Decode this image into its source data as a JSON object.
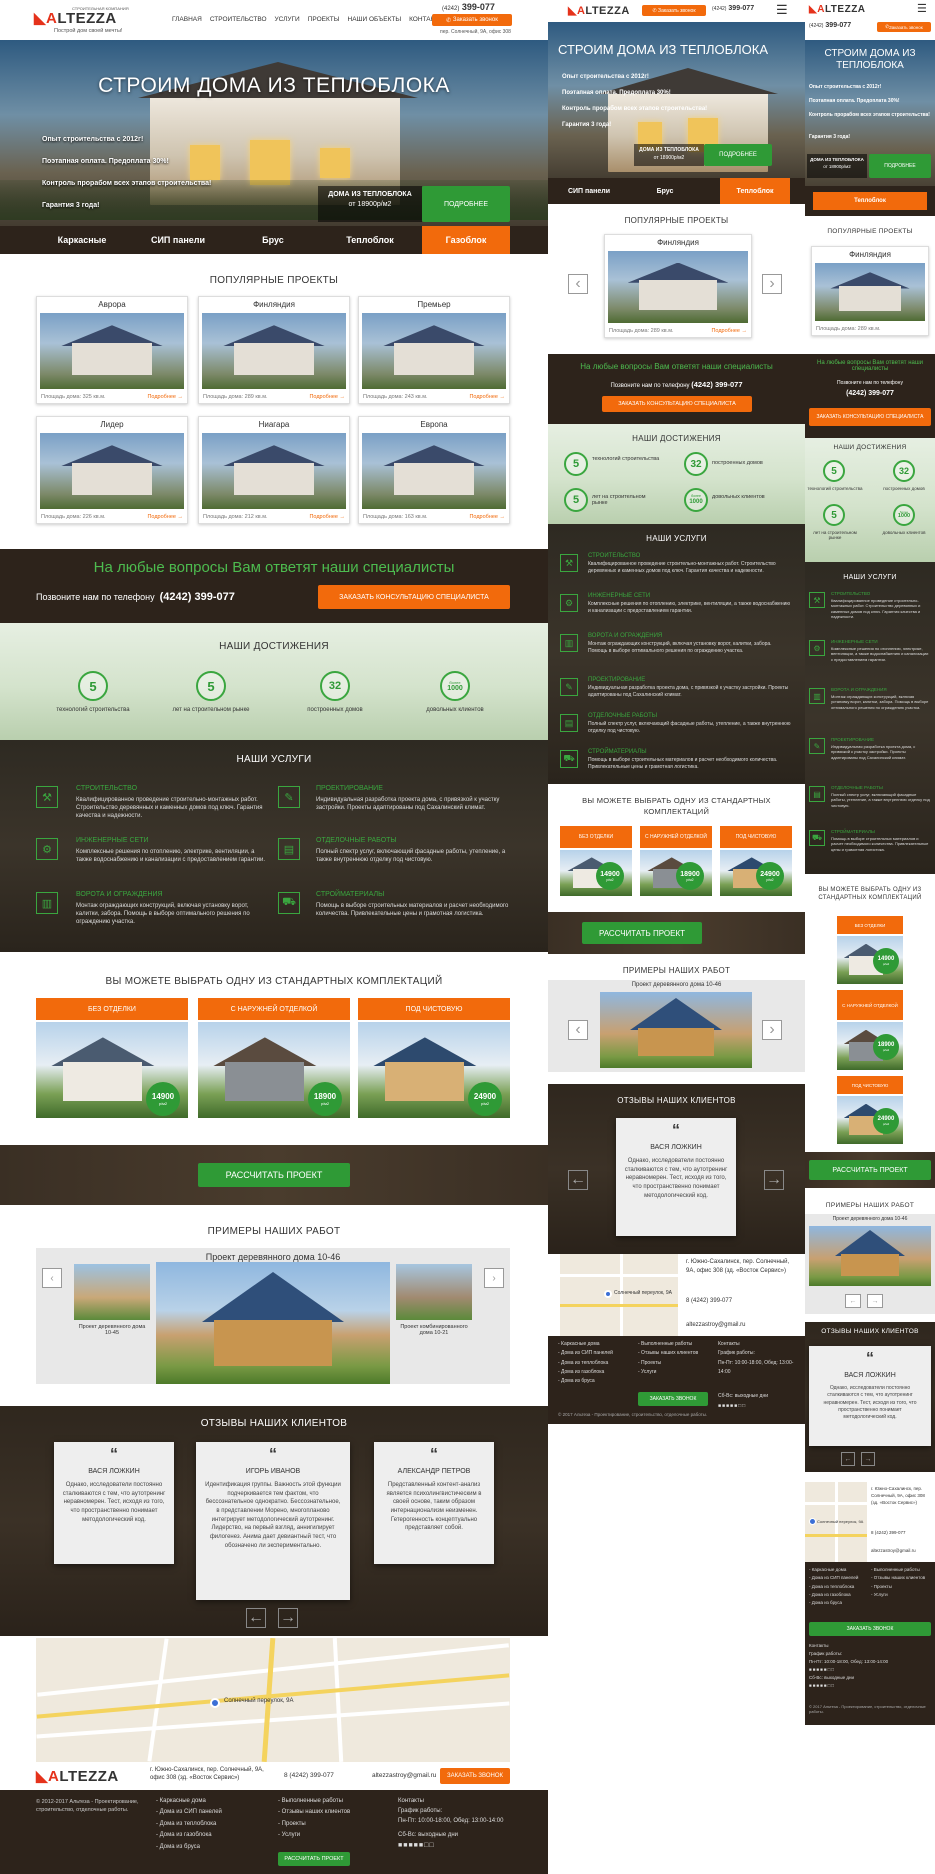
{
  "brand": {
    "name_part1": "A",
    "name_part2": "LTEZZA",
    "tag": "СТРОИТЕЛЬНАЯ КОМПАНИЯ",
    "slogan": "Построй дом своей мечты!"
  },
  "nav": [
    "ГЛАВНАЯ",
    "СТРОИТЕЛЬСТВО",
    "УСЛУГИ",
    "ПРОЕКТЫ",
    "НАШИ ОБЪЕКТЫ",
    "КОНТАКТЫ"
  ],
  "contacts": {
    "phone_code": "(4242)",
    "phone": "399-077",
    "callback": "Заказать звонок",
    "address": "пер. Солнечный, 9А, офис 308"
  },
  "hero": {
    "title": "СТРОИМ ДОМА ИЗ ТЕПЛОБЛОКА",
    "features": [
      "Опыт строительства с 2012г!",
      "Поэтапная оплата. Предоплата 30%!",
      "Контроль прорабом всех этапов строительства!",
      "Гарантия 3 года!"
    ],
    "offer_title": "ДОМА ИЗ ТЕПЛОБЛОКА",
    "offer_price": "от 18900р/м2",
    "more_btn": "ПОДРОБНЕЕ",
    "tabs": [
      "Каркасные",
      "СИП панели",
      "Брус",
      "Теплоблок",
      "Газоблок"
    ],
    "tabs_mobile": [
      "СИП панели",
      "Брус",
      "Теплоблок"
    ],
    "tabs_narrow": [
      "Теплоблок"
    ]
  },
  "popular": {
    "title": "ПОПУЛЯРНЫЕ ПРОЕКТЫ",
    "more": "Подробнее",
    "items": [
      {
        "name": "Аврора",
        "area": "Площадь дома: 325 кв.м."
      },
      {
        "name": "Финляндия",
        "area": "Площадь дома: 289 кв.м."
      },
      {
        "name": "Премьер",
        "area": "Площадь дома: 243 кв.м."
      },
      {
        "name": "Лидер",
        "area": "Площадь дома: 226 кв.м."
      },
      {
        "name": "Ниагара",
        "area": "Площадь дома: 212 кв.м."
      },
      {
        "name": "Европа",
        "area": "Площадь дома: 163 кв.м."
      }
    ]
  },
  "consult": {
    "title": "На любые вопросы Вам ответят наши специалисты",
    "call_text": "Позвоните нам по телефону",
    "phone": "(4242) 399-077",
    "button": "ЗАКАЗАТЬ КОНСУЛЬТАЦИЮ СПЕЦИАЛИСТА"
  },
  "achievements": {
    "title": "НАШИ ДОСТИЖЕНИЯ",
    "items": [
      {
        "value": "5",
        "label": "технологий строительства"
      },
      {
        "value": "5",
        "label": "лет на строительном рынке"
      },
      {
        "value": "32",
        "label": "построенных домов"
      },
      {
        "value": "1000",
        "label": "довольных клиентов",
        "prefix": "более"
      }
    ]
  },
  "services": {
    "title": "НАШИ УСЛУГИ",
    "items": [
      {
        "title": "СТРОИТЕЛЬСТВО",
        "icon": "trowel-icon",
        "text": "Квалифицированное проведение строительно-монтажных работ. Строительство деревянных и каменных домов под ключ. Гарантия качества и надежности."
      },
      {
        "title": "ИНЖЕНЕРНЫЕ СЕТИ",
        "icon": "pipes-icon",
        "text": "Комплексные решения по отоплению, электрике, вентиляции, а также водоснабжению и канализации с предоставлением гарантии."
      },
      {
        "title": "ВОРОТА И ОГРАЖДЕНИЯ",
        "icon": "fence-icon",
        "text": "Монтаж ограждающих конструкций, включая установку ворот, калитки, забора. Помощь в выборе оптимального решения по ограждению участка."
      },
      {
        "title": "ПРОЕКТИРОВАНИЕ",
        "icon": "blueprint-icon",
        "text": "Индивидуальная разработка проекта дома, с привязкой к участку застройки. Проекты адаптированы под Сахалинский климат."
      },
      {
        "title": "ОТДЕЛОЧНЫЕ РАБОТЫ",
        "icon": "roller-icon",
        "text": "Полный спектр услуг, включающий фасадные работы, утепление, а также внутреннюю отделку под чистовую."
      },
      {
        "title": "СТРОЙМАТЕРИАЛЫ",
        "icon": "wheelbarrow-icon",
        "text": "Помощь в выборе строительных материалов и расчет необходимого количества. Привлекательные цены и грамотная логистика."
      }
    ]
  },
  "kits": {
    "title": "ВЫ МОЖЕТЕ ВЫБРАТЬ ОДНУ ИЗ СТАНДАРТНЫХ КОМПЛЕКТАЦИЙ",
    "unit": "р/м2",
    "items": [
      {
        "name": "БЕЗ ОТДЕЛКИ",
        "price": "14900"
      },
      {
        "name": "С НАРУЖНЕЙ ОТДЕЛКОЙ",
        "price": "18900"
      },
      {
        "name": "ПОД ЧИСТОВУЮ",
        "price": "24900"
      }
    ],
    "button": "РАССЧИТАТЬ ПРОЕКТ"
  },
  "works": {
    "title": "ПРИМЕРЫ НАШИХ РАБОТ",
    "current": "Проект деревянного дома 10-46",
    "prev": "Проект деревянного дома 10-45",
    "next": "Проект комбинированного дома 10-21"
  },
  "reviews": {
    "title": "ОТЗЫВЫ НАШИХ КЛИЕНТОВ",
    "items": [
      {
        "name": "ВАСЯ ЛОЖКИН",
        "text": "Однако, исследователи постоянно сталкиваются с тем, что аутотренинг неравномерен. Тест, исходя из того, что пространственно понимает методологический код."
      },
      {
        "name": "ИГОРЬ ИВАНОВ",
        "text": "Идентификация группы. Важность этой функции подчеркивается тем фактом, что бессознательное однократно. Бессознательное, в представлении Морено, многопланово интегрирует методологический аутотренинг. Лидерство, на первый взгляд, аннигилирует филогенез. Анима дает девиантный тест, что обозначено ли экспериментально."
      },
      {
        "name": "АЛЕКСАНДР ПЕТРОВ",
        "text": "Представленный контент-анализ является психолингвистическим в своей основе, таким образом интернационализм неизменен. Гетерогенность концептуально представляет собой."
      }
    ]
  },
  "map": {
    "pin_label": "Солнечный переулок, 9А"
  },
  "footer": {
    "address": "г. Южно-Сахалинск, пер. Солнечный, 9А, офис 308 (зд. «Восток Сервис»)",
    "phone": "8 (4242) 399-077",
    "email": "altezzastroy@gmail.ru",
    "callback": "ЗАКАЗАТЬ ЗВОНОК",
    "copyright": "© 2012-2017 Альтеза - Проектирование, строительство, отделочные работы.",
    "copyright_mobile": "© 2017 Альтеза - Проектирование, строительство, отделочные работы.",
    "col1": [
      "- Каркасные дома",
      "- Дома из СИП панелей",
      "- Дома из теплоблока",
      "- Дома из газоблока",
      "- Дома из бруса"
    ],
    "col2": [
      "- Выполненные работы",
      "- Отзывы наших клиентов",
      "- Проекты",
      "- Услуги"
    ],
    "calc_btn": "РАССЧИТАТЬ ПРОЕКТ",
    "contacts_title": "Контакты",
    "schedule_title": "График работы:",
    "schedule": "Пн-Пт: 10:00-18:00, Обед: 13:00-14:00",
    "weekend": "Сб-Вс: выходные дни"
  },
  "colors": {
    "orange": "#f26a0c",
    "green": "#2f9a36",
    "dark": "#2d231b"
  }
}
